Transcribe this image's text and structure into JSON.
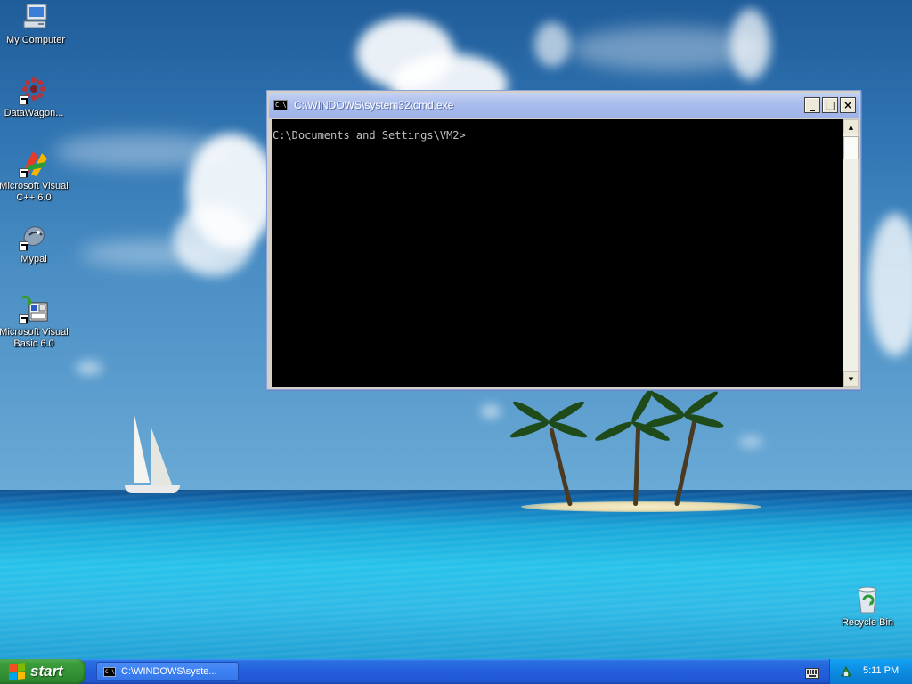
{
  "desktop": {
    "icons": [
      {
        "label": "My Computer",
        "icon": "my-computer-icon"
      },
      {
        "label": "DataWagon...",
        "icon": "datawagon-icon"
      },
      {
        "label": "Microsoft Visual\nC++ 6.0",
        "icon": "visual-cpp-icon"
      },
      {
        "label": "Mypal",
        "icon": "mypal-icon"
      },
      {
        "label": "Microsoft Visual\nBasic 6.0",
        "icon": "visual-basic-icon"
      },
      {
        "label": "Recycle Bin",
        "icon": "recycle-bin-icon"
      }
    ]
  },
  "window": {
    "title": "C:\\WINDOWS\\system32\\cmd.exe",
    "icon_text": "C:\\",
    "buttons": {
      "minimize": "_",
      "maximize": "□",
      "close": "×"
    },
    "console_text": "C:\\Documents and Settings\\VM2>"
  },
  "taskbar": {
    "start_label": "start",
    "task_button_label": "C:\\WINDOWS\\syste...",
    "task_icon_text": "C:\\",
    "clock": "5:11 PM"
  },
  "colors": {
    "titlebar_inactive": "#a9bcec",
    "taskbar_blue": "#245edb",
    "start_green": "#349234",
    "tray_blue": "#0d8be0"
  }
}
